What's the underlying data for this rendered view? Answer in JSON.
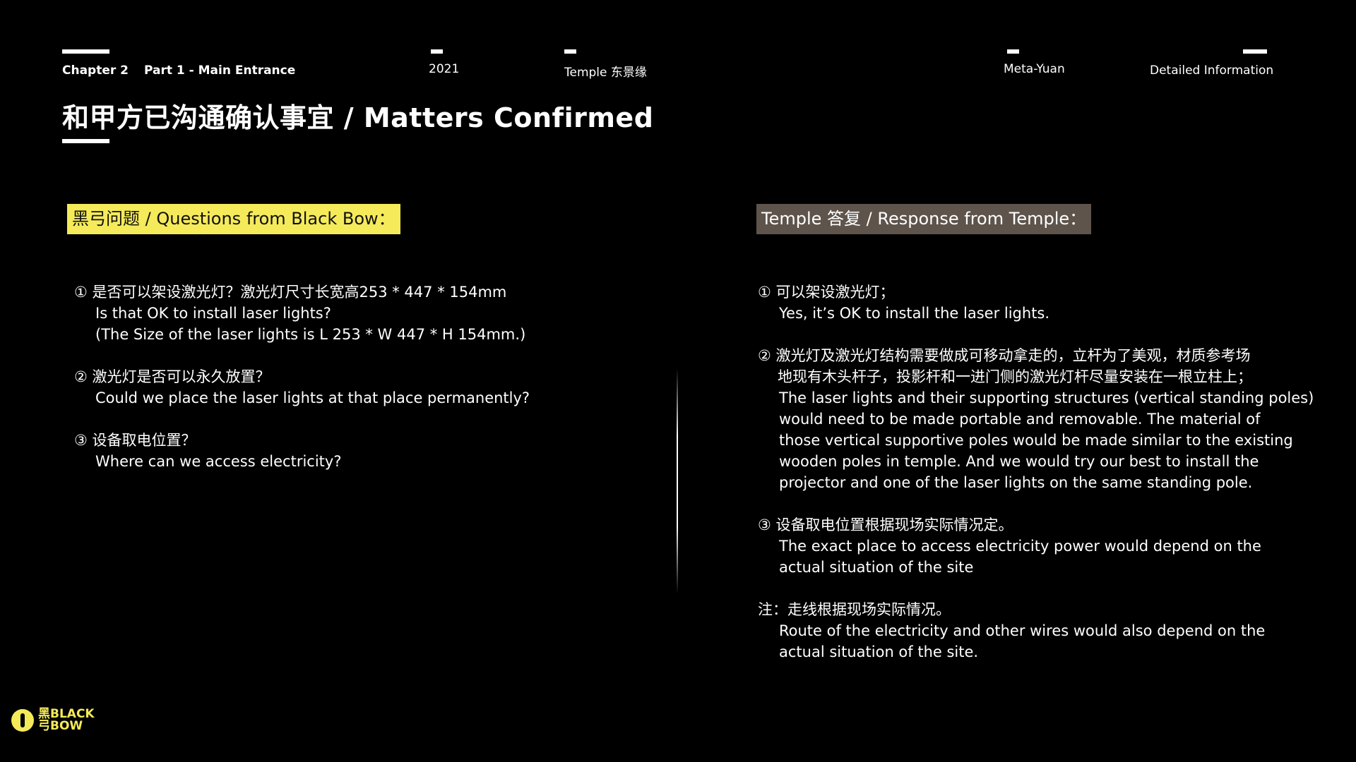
{
  "nav": {
    "chapter": "Chapter 2",
    "part": "Part 1 - Main Entrance",
    "year": "2021",
    "temple": "Temple 东景缘",
    "meta": "Meta-Yuan",
    "detail": "Detailed Information"
  },
  "title": "和甲方已沟通确认事宜 / Matters Confirmed",
  "left": {
    "tag": "黑弓问题 / Questions from Black Bow：",
    "items": [
      {
        "cn": "① 是否可以架设激光灯？激光灯尺寸长宽高253 * 447 * 154mm",
        "en": [
          "Is that OK to install laser lights?",
          "(The Size of the laser lights is L 253 * W 447 * H 154mm.)"
        ]
      },
      {
        "cn": "② 激光灯是否可以永久放置？",
        "en": [
          "Could we place the laser lights at that place permanently?"
        ]
      },
      {
        "cn": "③ 设备取电位置？",
        "en": [
          "Where can we access electricity?"
        ]
      }
    ]
  },
  "right": {
    "tag": "Temple 答复 / Response from Temple：",
    "items": [
      {
        "cn": [
          "① 可以架设激光灯；"
        ],
        "en": [
          "Yes, it’s OK to install the laser lights."
        ]
      },
      {
        "cn": [
          "② 激光灯及激光灯结构需要做成可移动拿走的，立杆为了美观，材质参考场",
          "地现有木头杆子，投影杆和一进门侧的激光灯杆尽量安装在一根立柱上；"
        ],
        "en": [
          "The laser lights and their supporting structures (vertical standing poles)",
          "would need to be made portable and removable. The material of",
          "those vertical supportive poles would be made similar to the existing",
          "wooden poles in temple. And we would try our best to install the",
          "projector and one of the laser lights on the same standing pole."
        ]
      },
      {
        "cn": [
          "③ 设备取电位置根据现场实际情况定。"
        ],
        "en": [
          "The exact place to access electricity power would depend on the",
          "actual situation of the site"
        ]
      },
      {
        "cn": [
          "注：走线根据现场实际情况。"
        ],
        "en": [
          "Route of the electricity and other wires would also depend on the",
          "actual situation of the site."
        ]
      }
    ]
  },
  "logo": {
    "line1": "黑BLACK",
    "line2": "弓BOW",
    "icon": "black-bow-logo-icon"
  },
  "colors": {
    "background": "#000000",
    "highlight_yellow": "#f5ea5a",
    "tag_brown": "#5e544c"
  }
}
